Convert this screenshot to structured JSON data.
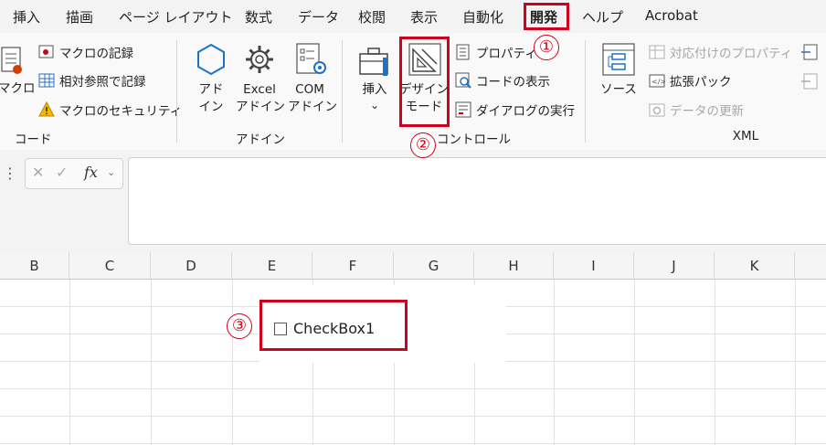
{
  "menu": {
    "items": [
      {
        "label": "挿入"
      },
      {
        "label": "描画"
      },
      {
        "label": "ページ レイアウト"
      },
      {
        "label": "数式"
      },
      {
        "label": "データ"
      },
      {
        "label": "校閲"
      },
      {
        "label": "表示"
      },
      {
        "label": "自動化"
      },
      {
        "label": "開発"
      },
      {
        "label": "ヘルプ"
      },
      {
        "label": "Acrobat"
      }
    ],
    "active_label": "開発"
  },
  "ribbon": {
    "code": {
      "macro_label": "マクロ",
      "record_macro": "マクロの記録",
      "relative_ref": "相対参照で記録",
      "macro_security": "マクロのセキュリティ",
      "group_label": "コード"
    },
    "addins": {
      "addin_label_1": "アド",
      "addin_label_2": "イン",
      "excel_addin_label_1": "Excel",
      "excel_addin_label_2": "アドイン",
      "com_addin_label_1": "COM",
      "com_addin_label_2": "アドイン",
      "group_label": "アドイン"
    },
    "controls": {
      "insert_label": "挿入",
      "insert_arrow": "⌄",
      "design_mode_1": "デザイン",
      "design_mode_2": "モード",
      "properties": "プロパティ",
      "view_code": "コードの表示",
      "run_dialog": "ダイアログの実行",
      "group_label": "コントロール"
    },
    "xml": {
      "source_label": "ソース",
      "map_properties": "対応付けのプロパティ",
      "expansion_packs": "拡張パック",
      "refresh_data": "データの更新",
      "group_label": "XML"
    }
  },
  "formula_bar": {
    "cancel_glyph": "✕",
    "enter_glyph": "✓",
    "fx_label": "fx",
    "dots": "⋮"
  },
  "columns": [
    "B",
    "C",
    "D",
    "E",
    "F",
    "G",
    "H",
    "I",
    "J",
    "K"
  ],
  "annotations": {
    "one": "①",
    "two": "②",
    "three": "③"
  },
  "checkbox": {
    "label": "CheckBox1",
    "checked": false
  },
  "colors": {
    "highlight_red": "#d0021b"
  }
}
